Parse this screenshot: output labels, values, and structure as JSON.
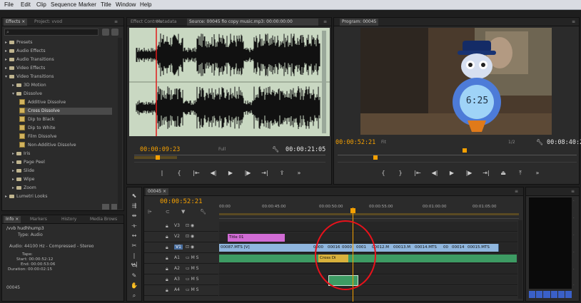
{
  "menu": [
    "File",
    "Edit",
    "Clip",
    "Sequence",
    "Marker",
    "Title",
    "Window",
    "Help"
  ],
  "effects_panel": {
    "tabs": [
      "Effects ×",
      "Project: vvod"
    ],
    "tree": [
      {
        "label": "Presets",
        "level": 0,
        "type": "folder"
      },
      {
        "label": "Audio Effects",
        "level": 0,
        "type": "folder"
      },
      {
        "label": "Audio Transitions",
        "level": 0,
        "type": "folder"
      },
      {
        "label": "Video Effects",
        "level": 0,
        "type": "folder"
      },
      {
        "label": "Video Transitions",
        "level": 0,
        "type": "folder",
        "open": true
      },
      {
        "label": "3D Motion",
        "level": 1,
        "type": "folder"
      },
      {
        "label": "Dissolve",
        "level": 1,
        "type": "folder",
        "open": true
      },
      {
        "label": "Additive Dissolve",
        "level": 2,
        "type": "fx"
      },
      {
        "label": "Cross Dissolve",
        "level": 2,
        "type": "fx",
        "selected": true
      },
      {
        "label": "Dip to Black",
        "level": 2,
        "type": "fx"
      },
      {
        "label": "Dip to White",
        "level": 2,
        "type": "fx"
      },
      {
        "label": "Film Dissolve",
        "level": 2,
        "type": "fx"
      },
      {
        "label": "Non-Additive Dissolve",
        "level": 2,
        "type": "fx"
      },
      {
        "label": "Iris",
        "level": 1,
        "type": "folder"
      },
      {
        "label": "Page Peel",
        "level": 1,
        "type": "folder"
      },
      {
        "label": "Slide",
        "level": 1,
        "type": "folder"
      },
      {
        "label": "Wipe",
        "level": 1,
        "type": "folder"
      },
      {
        "label": "Zoom",
        "level": 1,
        "type": "folder"
      },
      {
        "label": "Lumetri Looks",
        "level": 0,
        "type": "folder"
      }
    ]
  },
  "info_panel": {
    "tabs": [
      "Info ×",
      "Markers",
      "History",
      "Media Brows"
    ],
    "name": "/vvb hudhhump3",
    "type": "Type: Audio",
    "audio": "Audio: 44100 Hz - Compressed - Stereo",
    "tape": "Tape:",
    "start": "Start: 00:00:52:12",
    "end": "End: 00:00:53:06",
    "duration": "Duration: 00:00:02:15",
    "seq": "00045"
  },
  "source_monitor": {
    "tabs": [
      "Effect Controls",
      "Metadata",
      "Source: 00045 fio copy music.mp3: 00:00:00:00"
    ],
    "tc_left": "00:00:09:23",
    "tc_right": "00:00:21:05",
    "fit": "Full"
  },
  "program_monitor": {
    "tabs": [
      "Program: 00045"
    ],
    "tc_left": "00:00:52:21",
    "tc_right": "00:08:40:29",
    "fit": "Fit",
    "quality": "1/2",
    "clock_text": "6:25"
  },
  "timeline": {
    "tab": "00045 ×",
    "timecode": "00:00:52:21",
    "ruler": [
      "00:00",
      "00:00:45:00",
      "00:00:50:00",
      "00:00:55:00",
      "00:01:00:00",
      "00:01:05:00"
    ],
    "tracks": [
      {
        "name": "V3"
      },
      {
        "name": "V2"
      },
      {
        "name": "V1"
      },
      {
        "name": "A1"
      },
      {
        "name": "A2"
      },
      {
        "name": "A3"
      },
      {
        "name": "A4"
      }
    ],
    "v2_clip": "Title 01",
    "v1_clips": [
      "00087.MTS [V]",
      "0000",
      "00016",
      "0000",
      "0001",
      "00012.M",
      "00013.M",
      "00014.MTS",
      "00",
      "00014",
      "00015.MTS"
    ],
    "a1_clip": "Cross Di",
    "colors": {
      "video_clip": "#8fb6de",
      "audio_clip": "#3d9b63",
      "title_clip": "#d16bd4",
      "selection": "#e8121b",
      "timecode": "#f5a000"
    }
  }
}
